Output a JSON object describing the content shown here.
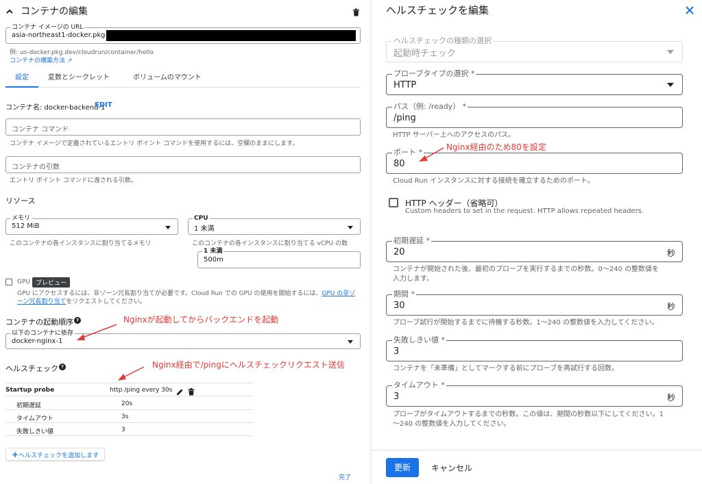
{
  "left": {
    "title": "コンテナの編集",
    "image_url_label": "コンテナ イメージの URL",
    "image_url_value": "asia-northeast1-docker.pkg.dev",
    "image_example": "例: us-docker.pkg.dev/cloudrun/container/hello",
    "image_help_link": "コンテナの構築方法",
    "tabs": [
      "設定",
      "変数とシークレット",
      "ボリュームのマウント"
    ],
    "container_name_label": "コンテナ名: docker-backend-1",
    "edit_link": "EDIT",
    "command_placeholder": "コンテナ コマンド",
    "command_help": "コンテナ イメージで定義されているエントリ ポイント コマンドを使用するには、空欄のままにします。",
    "args_placeholder": "コンテナの引数",
    "args_help": "エントリ ポイント コマンドに渡される引数。",
    "resources_title": "リソース",
    "memory_label": "メモリ",
    "memory_value": "512 MiB",
    "memory_help": "このコンテナの各インスタンスに割り当てるメモリ",
    "cpu_label": "CPU",
    "cpu_value": "1 未満",
    "cpu_help": "このコンテナの各インスタンスに割り当てる vCPU の数",
    "cpu_sub_label": "1 未満",
    "cpu_sub_value": "500m",
    "gpu_label": "GPU",
    "gpu_badge": "プレビュー",
    "gpu_help_1": "GPU にアクセスするには、非ゾーン冗長割り当てが必要です。Cloud Run での GPU の使用を開始するには、",
    "gpu_help_link": "GPU の非ゾーン冗長割り当て",
    "gpu_help_2": "をリクエストしてください。",
    "startup_order_title": "コンテナの起動順序",
    "depends_label": "以下のコンテナに依存",
    "depends_value": "docker-nginx-1",
    "healthcheck_title": "ヘルスチェック",
    "probe_name": "Startup probe",
    "probe_summary": "http /ping every 30s",
    "probe_rows": [
      {
        "k": "初期遅延",
        "v": "20s"
      },
      {
        "k": "タイムアウト",
        "v": "3s"
      },
      {
        "k": "失敗しきい値",
        "v": "3"
      }
    ],
    "add_healthcheck": "ヘルスチェックを追加します",
    "done": "完了"
  },
  "right": {
    "title": "ヘルスチェックを編集",
    "type_label": "ヘルスチェックの種類の選択",
    "type_value": "起動時チェック",
    "probe_label": "プローブタイプの選択 *",
    "probe_value": "HTTP",
    "path_label": "パス（例: /ready） *",
    "path_value": "/ping",
    "path_help": "HTTP サーバー上へのアクセスのパス。",
    "port_label": "ポート *",
    "port_value": "80",
    "port_help": "Cloud Run インスタンスに対する接続を確立するためのポート。",
    "headers_label": "HTTP ヘッダー（省略可）",
    "headers_help": "Custom headers to set in the request. HTTP allows repeated headers.",
    "initial_label": "初期遅延 *",
    "initial_value": "20",
    "initial_suffix": "秒",
    "initial_help_1": "コンテナが開始された後、最初のプローブを実行するまでの秒数。0〜240 の整数値を",
    "initial_help_2": "入力します。",
    "period_label": "期間 *",
    "period_value": "30",
    "period_suffix": "秒",
    "period_help": "プローブ試行が開始するまでに待機する秒数。1〜240 の整数値を入力してください。",
    "failure_label": "失敗しきい値 *",
    "failure_value": "3",
    "failure_help": "コンテナを「未準備」としてマークする前にプローブを再試行する回数。",
    "timeout_label": "タイムアウト *",
    "timeout_value": "3",
    "timeout_suffix": "秒",
    "timeout_help_1": "プローブがタイムアウトするまでの秒数。この値は、期間の秒数以下にしてください。1",
    "timeout_help_2": "〜240 の整数値を入力してください。",
    "update_button": "更新",
    "cancel_button": "キャンセル"
  },
  "annotations": {
    "nginx_start": "Nginxが起動してからバックエンドを起動",
    "nginx_ping": "Nginx経由で/pingにヘルスチェックリクエスト送信",
    "nginx_port": "Nginx経由のため80を設定"
  },
  "colors": {
    "accent": "#1a73e8",
    "annotation": "#e53935",
    "badge_bg": "#3c4043"
  }
}
